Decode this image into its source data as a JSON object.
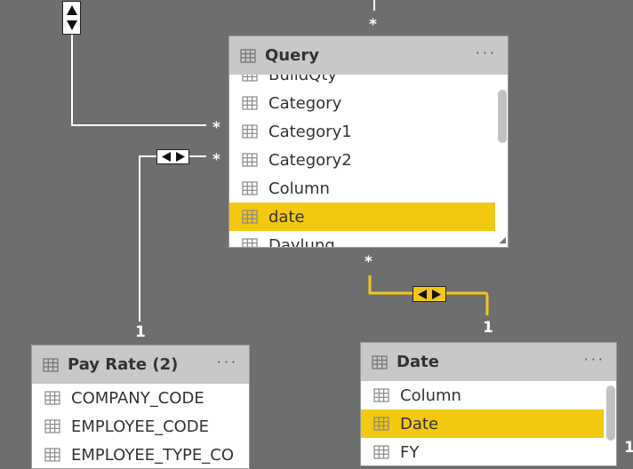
{
  "relationships": {
    "top_left_end": "*",
    "top_mid_end": "*",
    "query_left_upper_end": "*",
    "query_left_lower_end": "*",
    "query_bottom_end": "*",
    "pay_rate_end": "1",
    "date_end": "1",
    "right_edge_end": "1"
  },
  "query_table": {
    "title": "Query",
    "more_label": "···",
    "fields": [
      {
        "label": "BuildQty",
        "selected": false
      },
      {
        "label": "Category",
        "selected": false
      },
      {
        "label": "Category1",
        "selected": false
      },
      {
        "label": "Category2",
        "selected": false
      },
      {
        "label": "Column",
        "selected": false
      },
      {
        "label": "date",
        "selected": true
      },
      {
        "label": "Daylung",
        "selected": false
      }
    ]
  },
  "pay_rate_table": {
    "title": "Pay Rate (2)",
    "more_label": "···",
    "fields": [
      {
        "label": "COMPANY_CODE",
        "selected": false
      },
      {
        "label": "EMPLOYEE_CODE",
        "selected": false
      },
      {
        "label": "EMPLOYEE_TYPE_CO",
        "selected": false
      }
    ]
  },
  "date_table": {
    "title": "Date",
    "more_label": "···",
    "fields": [
      {
        "label": "Column",
        "selected": false
      },
      {
        "label": "Date",
        "selected": true
      },
      {
        "label": "FY",
        "selected": false
      }
    ]
  },
  "colors": {
    "canvas": "#6e6e6e",
    "highlight": "#f2c811",
    "header": "#c8c8c8",
    "line": "#ffffff"
  },
  "icons": {
    "table": "table-grid-icon",
    "field": "field-grid-icon",
    "cross_filter_both": "bidirectional-arrows-icon",
    "cross_filter_vertical": "up-down-arrows-icon"
  }
}
